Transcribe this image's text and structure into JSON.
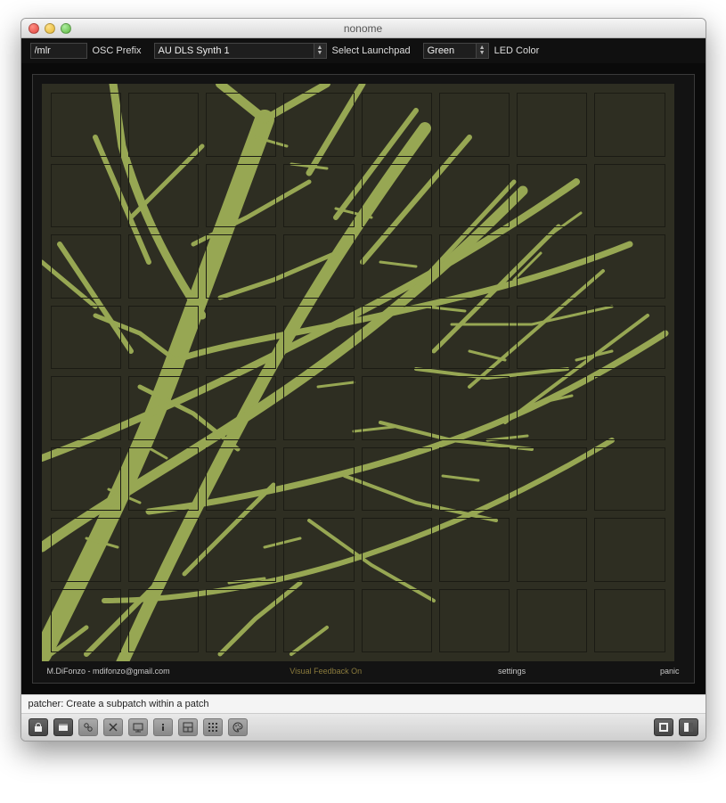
{
  "window": {
    "title": "nonome"
  },
  "topbar": {
    "osc_prefix_value": "/mlr",
    "osc_prefix_label": "OSC Prefix",
    "synth_selected": "AU DLS Synth 1",
    "synth_label": "Select Launchpad",
    "led_color_selected": "Green",
    "led_color_label": "LED Color"
  },
  "stage": {
    "grid_rows": 8,
    "grid_cols": 8,
    "credit": "M.DiFonzo - mdifonzo@gmail.com",
    "feedback_text": "Visual Feedback On",
    "settings_label": "settings",
    "panic_label": "panic"
  },
  "hint": "patcher: Create a subpatch within a patch",
  "toolbar_icons": [
    "lock",
    "window",
    "link",
    "close-x",
    "board",
    "info",
    "layout",
    "grid",
    "palette",
    "view-compact",
    "view-split"
  ]
}
